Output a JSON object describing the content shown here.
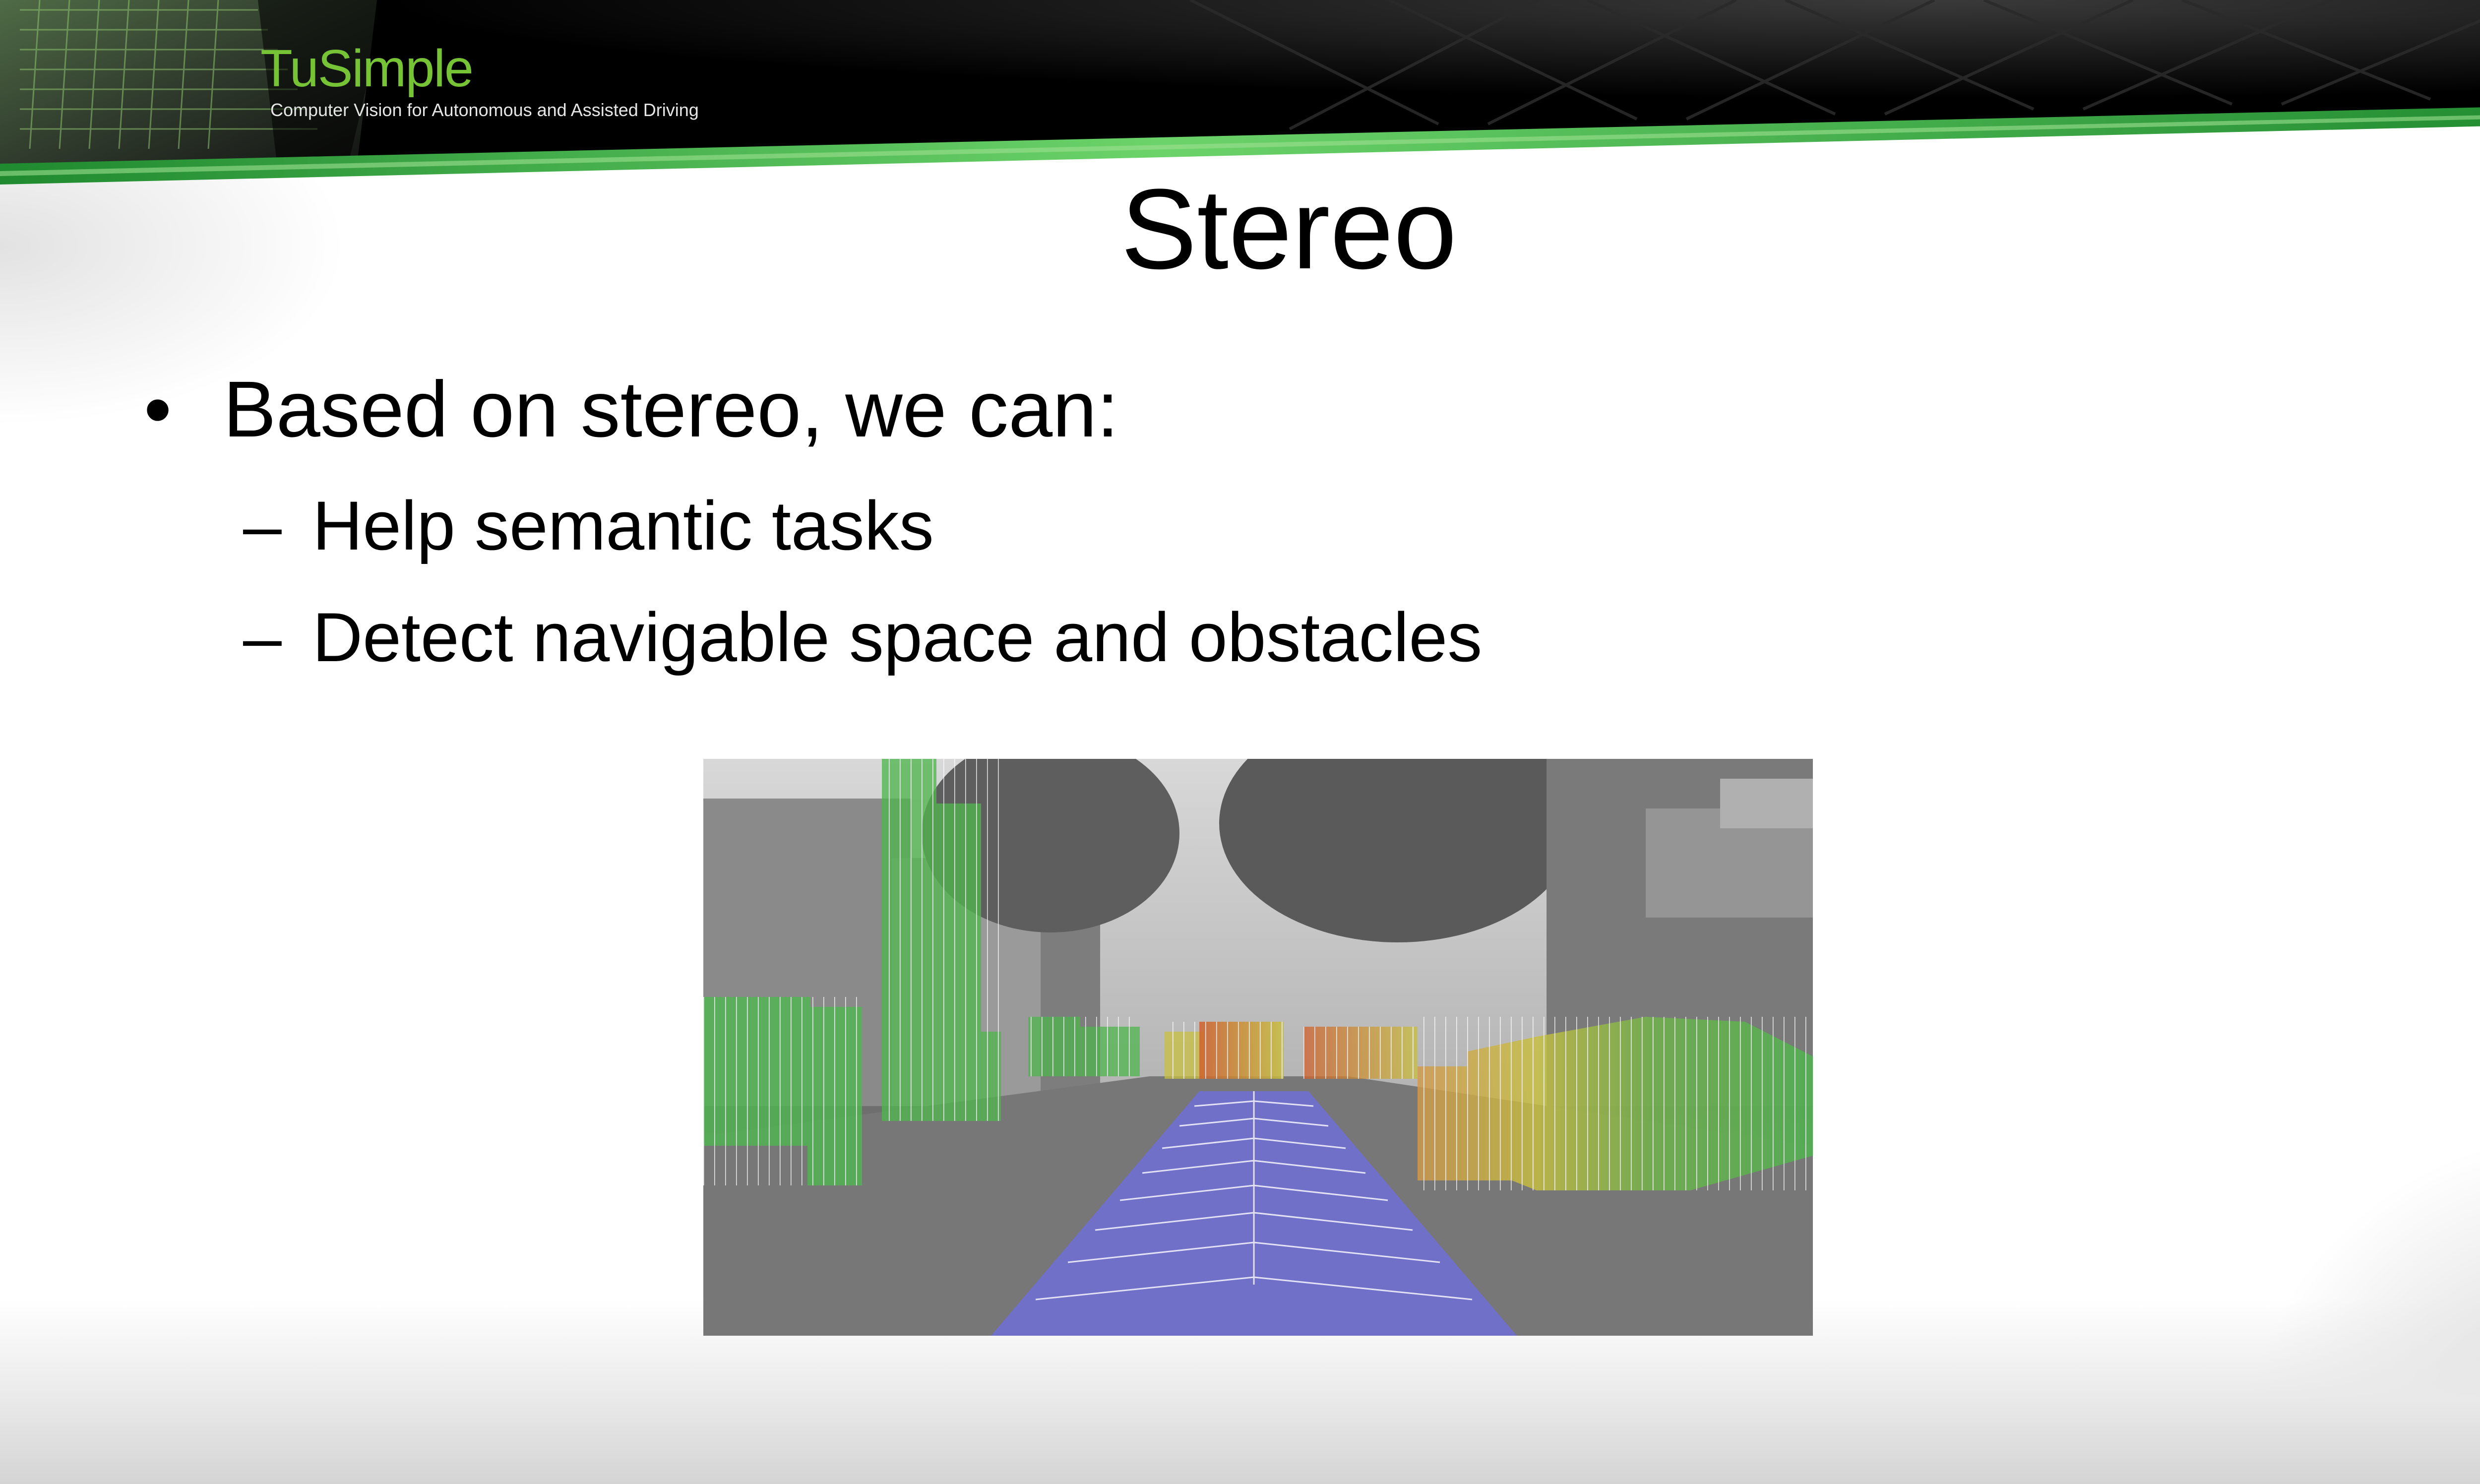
{
  "header": {
    "logo_wordmark": "TuSimple",
    "logo_tagline": "Computer Vision for Autonomous and Assisted Driving",
    "accent_color": "#76c335",
    "bar_color": "#000000"
  },
  "slide": {
    "title": "Stereo",
    "bullets": [
      {
        "marker": "•",
        "text": "Based on stereo, we can:",
        "sub_items": [
          {
            "marker": "–",
            "text": "Help semantic tasks"
          },
          {
            "marker": "–",
            "text": "Detect navigable space and obstacles"
          }
        ]
      }
    ]
  },
  "figure": {
    "description_icon": "stereo-street-scene",
    "colors": {
      "free_space": "#6f6fd6",
      "obstacle_far": "#4fb64f",
      "obstacle_mid": "#c8c040",
      "obstacle_near": "#d0602c"
    }
  }
}
